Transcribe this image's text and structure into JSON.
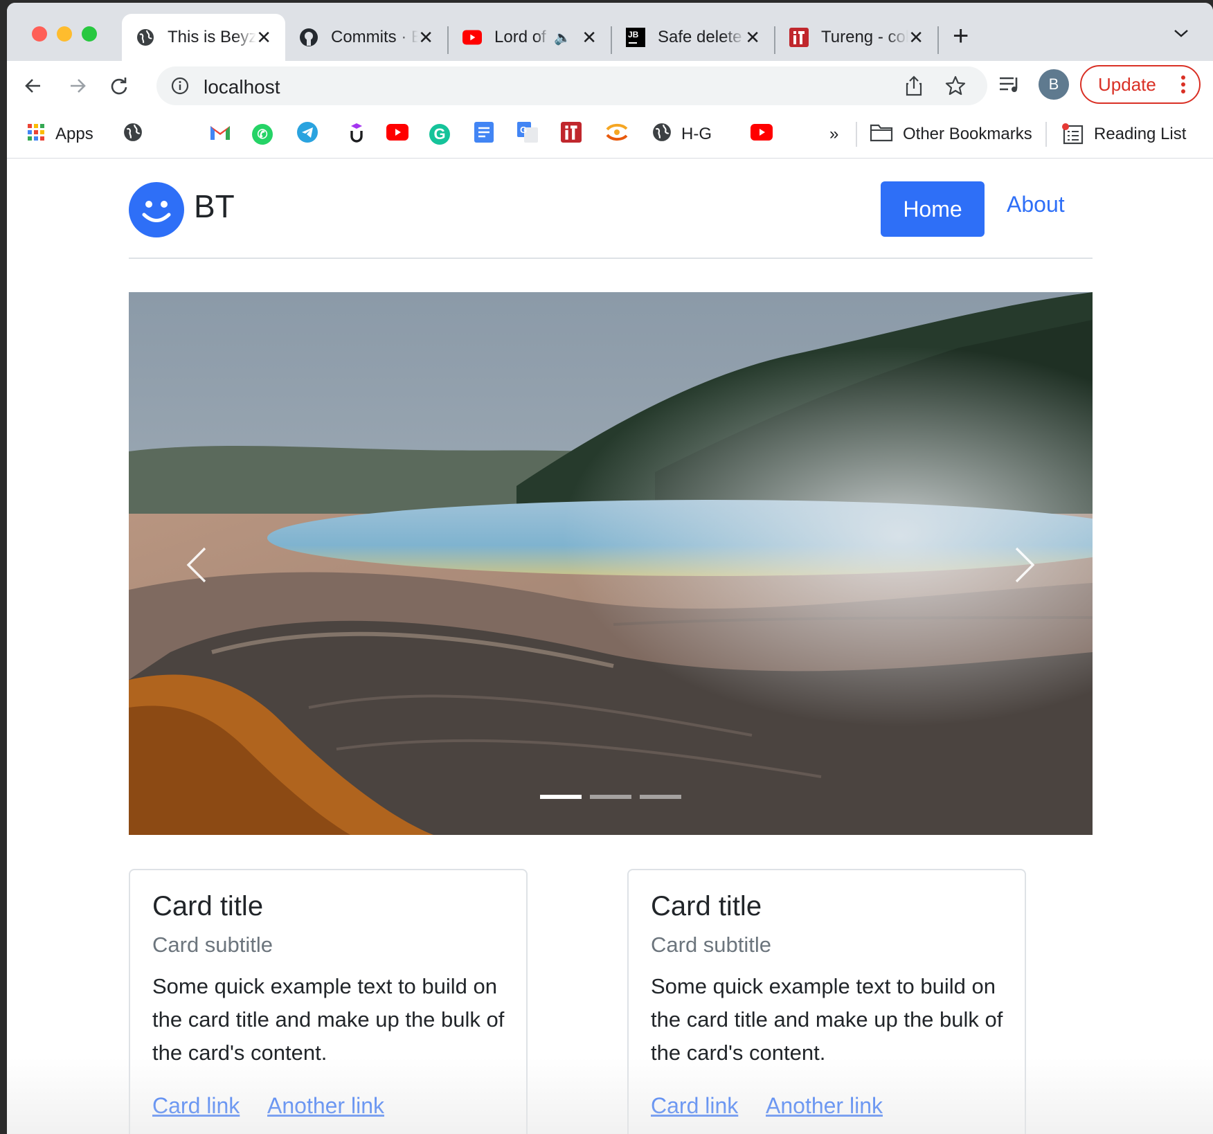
{
  "browser": {
    "tabs": [
      {
        "label": "This is Beyza's Website",
        "icon": "globe-icon",
        "active": true
      },
      {
        "label": "Commits · Beyza",
        "icon": "github-icon"
      },
      {
        "label": "Lord of the Rings",
        "icon": "youtube-icon",
        "audio": true
      },
      {
        "label": "Safe delete",
        "icon": "jetbrains-icon"
      },
      {
        "label": "Tureng - collect",
        "icon": "tureng-icon"
      }
    ],
    "address": "localhost",
    "profile_initial": "B",
    "update_label": "Update",
    "bookmarks": {
      "apps_label": "Apps",
      "hg_label": "H-G",
      "overflow": "»",
      "other_label": "Other Bookmarks",
      "reading_label": "Reading List"
    }
  },
  "site": {
    "brand": "BT",
    "nav": {
      "home": "Home",
      "about": "About"
    },
    "carousel": {
      "slides": 3,
      "active_index": 0
    },
    "cards": [
      {
        "title": "Card title",
        "subtitle": "Card subtitle",
        "text": "Some quick example text to build on the card title and make up the bulk of the card's content.",
        "link1": "Card link",
        "link2": "Another link"
      },
      {
        "title": "Card title",
        "subtitle": "Card subtitle",
        "text": "Some quick example text to build on the card title and make up the bulk of the card's content.",
        "link1": "Card link",
        "link2": "Another link"
      }
    ]
  },
  "colors": {
    "primary": "#2e6ff7",
    "update_red": "#d93025"
  }
}
